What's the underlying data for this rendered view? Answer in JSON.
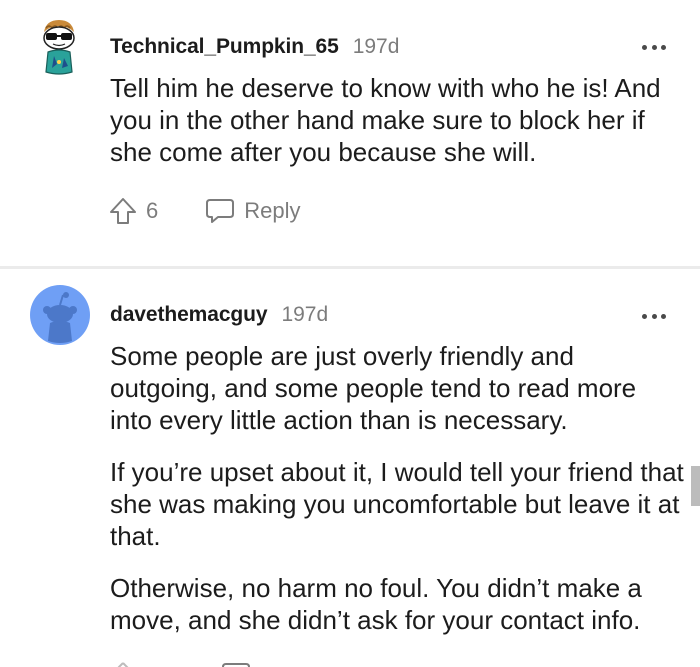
{
  "comments": [
    {
      "username": "Technical_Pumpkin_65",
      "age": "197d",
      "paragraphs": [
        "Tell him he deserve to know with who he is! And you in the other hand make sure to block her if she come after you because she will."
      ],
      "vote_count": "6",
      "reply_label": "Reply"
    },
    {
      "username": "davethemacguy",
      "age": "197d",
      "paragraphs": [
        "Some people are just overly friendly and outgoing, and some people tend to read more into every little action than is necessary.",
        "If you’re upset about it, I would tell your friend that she was making you uncomfortable but leave it at that.",
        "Otherwise, no harm no foul. You didn’t make a move, and she didn’t ask for your contact info."
      ]
    }
  ],
  "icons": {
    "more": "more-options-icon",
    "upvote": "upvote-arrow-icon",
    "reply": "reply-bubble-icon",
    "avatar_1": "snoo-sunglasses-avatar",
    "avatar_2": "snoo-default-avatar"
  },
  "colors": {
    "text": "#1c1c1c",
    "meta": "#7c7c7c",
    "avatar_blue": "#6f9ff5",
    "divider": "#ebebeb"
  }
}
